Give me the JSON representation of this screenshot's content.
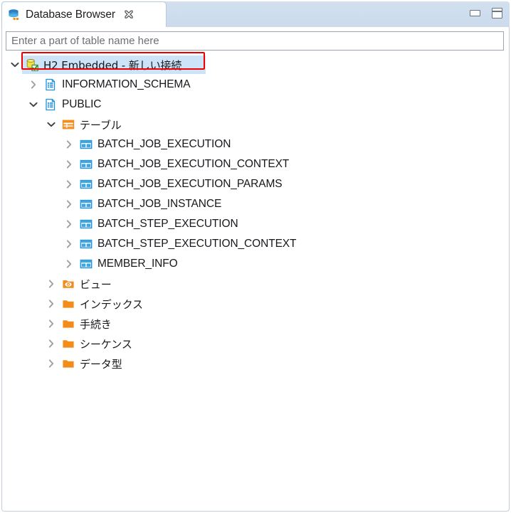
{
  "window": {
    "minimize_label": "Minimize",
    "maximize_label": "Maximize",
    "minimize_icon": "minimize-icon",
    "maximize_icon": "maximize-icon"
  },
  "tab": {
    "title": "Database Browser",
    "icon": "database-stack-icon",
    "close_icon": "close-icon"
  },
  "filter": {
    "placeholder": "Enter a part of table name here",
    "value": ""
  },
  "tree": {
    "nodes": [
      {
        "label": "H2 Embedded - 新しい接続",
        "icon": "database-connected-icon",
        "indent": 0,
        "state": "expanded",
        "selected": true,
        "highlighted": true
      },
      {
        "label": "INFORMATION_SCHEMA",
        "icon": "schema-icon",
        "indent": 1,
        "state": "collapsed",
        "selected": false,
        "highlighted": false
      },
      {
        "label": "PUBLIC",
        "icon": "schema-icon",
        "indent": 1,
        "state": "expanded",
        "selected": false,
        "highlighted": false
      },
      {
        "label": "テーブル",
        "icon": "tables-folder-icon",
        "indent": 2,
        "state": "expanded",
        "selected": false,
        "highlighted": false
      },
      {
        "label": "BATCH_JOB_EXECUTION",
        "icon": "table-icon",
        "indent": 3,
        "state": "collapsed",
        "selected": false,
        "highlighted": false
      },
      {
        "label": "BATCH_JOB_EXECUTION_CONTEXT",
        "icon": "table-icon",
        "indent": 3,
        "state": "collapsed",
        "selected": false,
        "highlighted": false
      },
      {
        "label": "BATCH_JOB_EXECUTION_PARAMS",
        "icon": "table-icon",
        "indent": 3,
        "state": "collapsed",
        "selected": false,
        "highlighted": false
      },
      {
        "label": "BATCH_JOB_INSTANCE",
        "icon": "table-icon",
        "indent": 3,
        "state": "collapsed",
        "selected": false,
        "highlighted": false
      },
      {
        "label": "BATCH_STEP_EXECUTION",
        "icon": "table-icon",
        "indent": 3,
        "state": "collapsed",
        "selected": false,
        "highlighted": false
      },
      {
        "label": "BATCH_STEP_EXECUTION_CONTEXT",
        "icon": "table-icon",
        "indent": 3,
        "state": "collapsed",
        "selected": false,
        "highlighted": false
      },
      {
        "label": "MEMBER_INFO",
        "icon": "table-icon",
        "indent": 3,
        "state": "collapsed",
        "selected": false,
        "highlighted": false
      },
      {
        "label": "ビュー",
        "icon": "views-folder-icon",
        "indent": 2,
        "state": "collapsed",
        "selected": false,
        "highlighted": false
      },
      {
        "label": "インデックス",
        "icon": "folder-icon",
        "indent": 2,
        "state": "collapsed",
        "selected": false,
        "highlighted": false
      },
      {
        "label": "手続き",
        "icon": "folder-icon",
        "indent": 2,
        "state": "collapsed",
        "selected": false,
        "highlighted": false
      },
      {
        "label": "シーケンス",
        "icon": "folder-icon",
        "indent": 2,
        "state": "collapsed",
        "selected": false,
        "highlighted": false
      },
      {
        "label": "データ型",
        "icon": "folder-icon",
        "indent": 2,
        "state": "collapsed",
        "selected": false,
        "highlighted": false
      }
    ]
  },
  "annotation": {
    "color": "#ef0000",
    "target": "H2 Embedded - 新しい接続"
  },
  "colors": {
    "tab_bar": "#cddeef",
    "selection": "#cde3f7",
    "accent_orange": "#f28c1b",
    "accent_blue": "#1e90e0",
    "annotation_red": "#ef0000"
  }
}
